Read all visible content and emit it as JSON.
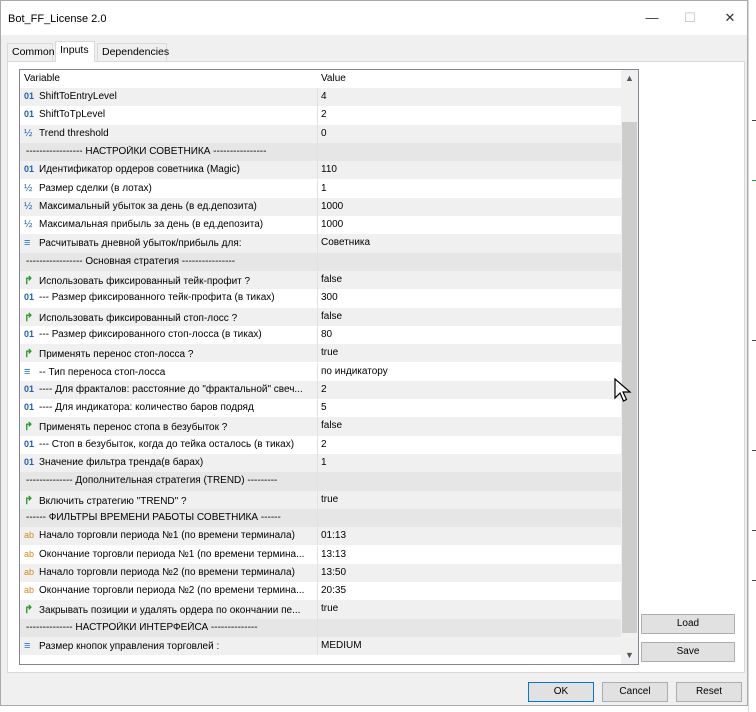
{
  "window": {
    "title": "Bot_FF_License 2.0",
    "minimize": "—",
    "maximize": "☐",
    "close": "✕"
  },
  "tabs": [
    {
      "label": "Common"
    },
    {
      "label": "Inputs"
    },
    {
      "label": "Dependencies"
    }
  ],
  "grid": {
    "headers": {
      "variable": "Variable",
      "value": "Value"
    },
    "rows": [
      {
        "icon": "01",
        "type": "int",
        "name": "ShiftToEntryLevel",
        "value": "4"
      },
      {
        "icon": "01",
        "type": "int",
        "name": "ShiftToTpLevel",
        "value": "2"
      },
      {
        "icon": "½",
        "type": "double",
        "name": "Trend threshold",
        "value": "0"
      },
      {
        "icon": "",
        "type": "section",
        "name": "----------------- НАСТРОЙКИ СОВЕТНИКА ----------------",
        "value": ""
      },
      {
        "icon": "01",
        "type": "int",
        "name": "Идентификатор ордеров советника (Magic)",
        "value": "110"
      },
      {
        "icon": "½",
        "type": "double",
        "name": "Размер сделки (в лотах)",
        "value": "1"
      },
      {
        "icon": "½",
        "type": "double",
        "name": "Максимальный убыток за день (в ед.депозита)",
        "value": "1000"
      },
      {
        "icon": "½",
        "type": "double",
        "name": "Максимальная прибыль за день (в ед.депозита)",
        "value": "1000"
      },
      {
        "icon": "≡",
        "type": "enum",
        "name": "Расчитывать дневной убыток/прибыль для:",
        "value": "Советника"
      },
      {
        "icon": "",
        "type": "section",
        "name": "----------------- Основная стратегия ----------------",
        "value": ""
      },
      {
        "icon": "↱",
        "type": "bool",
        "name": "Использовать фиксированный тейк-профит ?",
        "value": "false"
      },
      {
        "icon": "01",
        "type": "int",
        "name": "--- Размер фиксированного тейк-профита (в тиках)",
        "value": "300"
      },
      {
        "icon": "↱",
        "type": "bool",
        "name": "Использовать фиксированный стоп-лосс ?",
        "value": "false"
      },
      {
        "icon": "01",
        "type": "int",
        "name": "--- Размер фиксированного стоп-лосса (в тиках)",
        "value": "80"
      },
      {
        "icon": "↱",
        "type": "bool",
        "name": "Применять перенос стоп-лосса ?",
        "value": "true"
      },
      {
        "icon": "≡",
        "type": "enum",
        "name": "-- Тип переноса стоп-лосса",
        "value": "по индикатору"
      },
      {
        "icon": "01",
        "type": "int",
        "name": "---- Для фракталов: расстояние до \"фрактальной\" свеч...",
        "value": "2"
      },
      {
        "icon": "01",
        "type": "int",
        "name": "---- Для индикатора: количество баров подряд",
        "value": "5"
      },
      {
        "icon": "↱",
        "type": "bool",
        "name": "Применять перенос стопа в безубыток ?",
        "value": "false"
      },
      {
        "icon": "01",
        "type": "int",
        "name": "--- Стоп в безубыток, когда до тейка осталось (в тиках)",
        "value": "2"
      },
      {
        "icon": "01",
        "type": "int",
        "name": "Значение фильтра тренда(в барах)",
        "value": "1"
      },
      {
        "icon": "",
        "type": "section",
        "name": "-------------- Дополнительная стратегия (TREND) ---------",
        "value": ""
      },
      {
        "icon": "↱",
        "type": "bool",
        "name": "Включить стратегию \"TREND\" ?",
        "value": "true"
      },
      {
        "icon": "",
        "type": "section",
        "name": "------ ФИЛЬТРЫ ВРЕМЕНИ РАБОТЫ СОВЕТНИКА ------",
        "value": ""
      },
      {
        "icon": "ab",
        "type": "string",
        "name": "Начало торговли периода №1 (по времени терминала)",
        "value": "01:13"
      },
      {
        "icon": "ab",
        "type": "string",
        "name": "Окончание торговли периода №1 (по времени термина...",
        "value": "13:13"
      },
      {
        "icon": "ab",
        "type": "string",
        "name": "Начало торговли периода №2 (по времени терминала)",
        "value": "13:50"
      },
      {
        "icon": "ab",
        "type": "string",
        "name": "Окончание торговли периода №2 (по времени термина...",
        "value": "20:35"
      },
      {
        "icon": "↱",
        "type": "bool",
        "name": "Закрывать позиции и удалять ордера по окончании пе...",
        "value": "true"
      },
      {
        "icon": "",
        "type": "section",
        "name": "-------------- НАСТРОЙКИ ИНТЕРФЕЙСА --------------",
        "value": ""
      },
      {
        "icon": "≡",
        "type": "enum",
        "name": "Размер кнопок управления торговлей :",
        "value": "MEDIUM"
      }
    ]
  },
  "buttons": {
    "load": "Load",
    "save": "Save",
    "ok": "OK",
    "cancel": "Cancel",
    "reset": "Reset"
  }
}
